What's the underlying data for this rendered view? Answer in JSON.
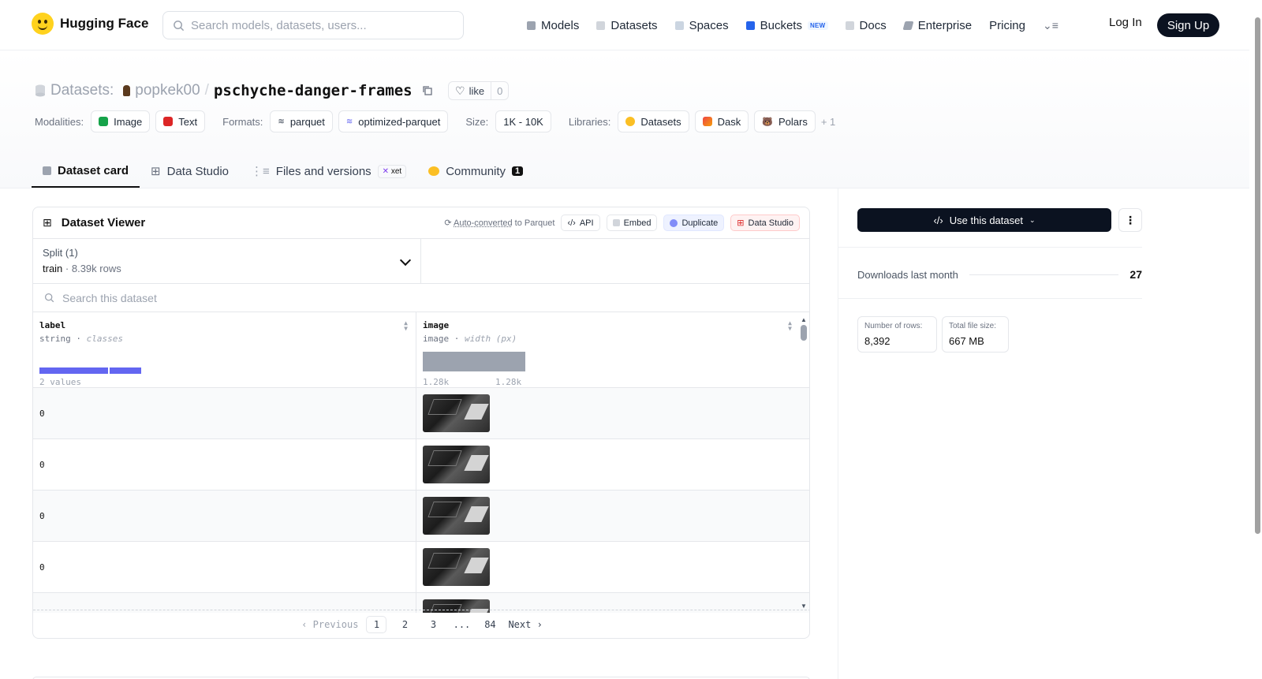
{
  "header": {
    "brand": "Hugging Face",
    "search_placeholder": "Search models, datasets, users...",
    "nav": [
      {
        "label": "Models",
        "icon": "cube-icon",
        "color": "#6b7280"
      },
      {
        "label": "Datasets",
        "icon": "database-icon",
        "color": "#9ca3af"
      },
      {
        "label": "Spaces",
        "icon": "grid-icon",
        "color": "#9ca3af"
      },
      {
        "label": "Buckets",
        "icon": "bucket-icon",
        "color": "#2563eb"
      },
      {
        "label": "Docs",
        "icon": "book-icon",
        "color": "#9ca3af"
      },
      {
        "label": "Enterprise",
        "icon": "enterprise-icon",
        "color": "#6b7280"
      },
      {
        "label": "Pricing"
      }
    ],
    "new_badge": "NEW",
    "login": "Log In",
    "signup": "Sign Up"
  },
  "repo": {
    "type_label": "Datasets:",
    "owner": "popkek00",
    "separator": "/",
    "name": "pschyche-danger-frames",
    "like_label": "like",
    "like_count": "0"
  },
  "tags": {
    "modalities_label": "Modalities:",
    "modalities": [
      "Image",
      "Text"
    ],
    "formats_label": "Formats:",
    "formats": [
      "parquet",
      "optimized-parquet"
    ],
    "size_label": "Size:",
    "size": "1K - 10K",
    "libraries_label": "Libraries:",
    "libraries": [
      "Datasets",
      "Dask",
      "Polars"
    ],
    "libraries_more": "+ 1"
  },
  "tabs": [
    {
      "label": "Dataset card",
      "active": true
    },
    {
      "label": "Data Studio"
    },
    {
      "label": "Files and versions",
      "badge": "xet"
    },
    {
      "label": "Community",
      "count": "1"
    }
  ],
  "viewer": {
    "title": "Dataset Viewer",
    "auto_converted": "Auto-converted",
    "to_parquet": " to Parquet",
    "api": "API",
    "embed": "Embed",
    "duplicate": "Duplicate",
    "data_studio": "Data Studio",
    "split_label": "Split (1)",
    "split_name": "train",
    "split_rows": "8.39k rows",
    "search_placeholder": "Search this dataset",
    "columns": [
      {
        "name": "label",
        "type": "string",
        "stat": "classes",
        "footer": "2 values"
      },
      {
        "name": "image",
        "type": "image",
        "stat": "width (px)",
        "min": "1.28k",
        "max": "1.28k"
      }
    ],
    "rows": [
      {
        "label": "0"
      },
      {
        "label": "0"
      },
      {
        "label": "0"
      },
      {
        "label": "0"
      },
      {
        "label": ""
      }
    ],
    "pager": {
      "previous": "Previous",
      "pages": [
        "1",
        "2",
        "3",
        "...",
        "84"
      ],
      "next": "Next"
    }
  },
  "sidebar": {
    "use_button": "Use this dataset",
    "downloads_label": "Downloads last month",
    "downloads_value": "27",
    "rows_label": "Number of rows:",
    "rows_value": "8,392",
    "size_label": "Total file size:",
    "size_value": "667 MB"
  }
}
